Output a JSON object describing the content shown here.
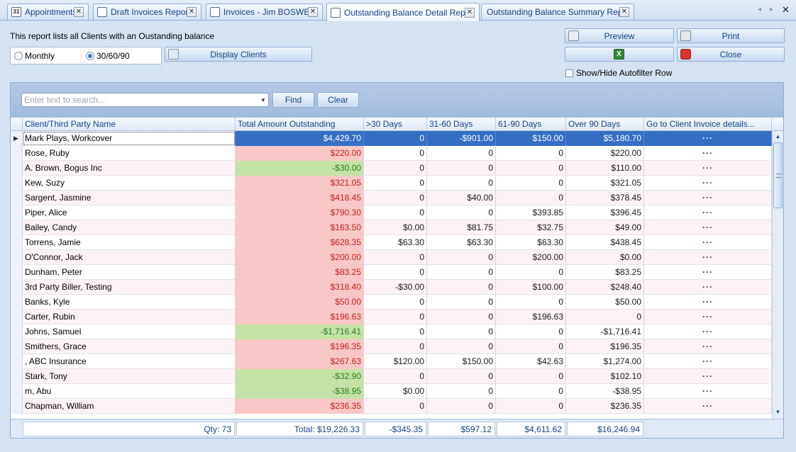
{
  "tabs": [
    {
      "label": "Appointments",
      "icon": "calendar-icon",
      "icon_text": "31",
      "active": false
    },
    {
      "label": "Draft Invoices Report",
      "icon": "report-icon",
      "icon_text": "",
      "active": false
    },
    {
      "label": "Invoices - Jim BOSWELL",
      "icon": "document-icon",
      "icon_text": "",
      "active": false
    },
    {
      "label": "Outstanding Balance Detail Report",
      "icon": "report-icon",
      "icon_text": "",
      "active": true
    },
    {
      "label": "Outstanding Balance Summary Report",
      "icon": "",
      "icon_text": "",
      "active": false
    }
  ],
  "tab_close_glyph": "✕",
  "tab_nav": {
    "prev": "◂",
    "next": "▸",
    "close_all": "✕"
  },
  "report": {
    "description": "This report lists all Clients with an Oustanding balance",
    "radio_monthly": "Monthly",
    "radio_306090": "30/60/90",
    "selected_period": "30/60/90",
    "display_clients": "Display Clients",
    "preview": "Preview",
    "print": "Print",
    "excel_icon_text": "X",
    "close": "Close",
    "autofilter_label": "Show/Hide Autofilter Row",
    "autofilter_checked": false
  },
  "search": {
    "placeholder": "Enter text to search...",
    "find": "Find",
    "clear": "Clear"
  },
  "columns": [
    "Client/Third Party Name",
    "Total Amount Outstanding",
    ">30 Days",
    "31-60 Days",
    "61-90 Days",
    "Over 90 Days",
    "Go to Client Invoice details..."
  ],
  "row_indicator": "▶",
  "row_action_glyph": "···",
  "rows": [
    {
      "name": "Mark Plays, Workcover",
      "total": "$4,429.70",
      "total_sign": "pos",
      "d30": "0",
      "d60": "-$901.00",
      "d90": "$150.00",
      "over90": "$5,180.70",
      "selected": true
    },
    {
      "name": "Rose, Ruby",
      "total": "$220.00",
      "total_sign": "pos",
      "d30": "0",
      "d60": "0",
      "d90": "0",
      "over90": "$220.00"
    },
    {
      "name": "A. Brown, Bogus Inc",
      "total": "-$30.00",
      "total_sign": "neg",
      "d30": "0",
      "d60": "0",
      "d90": "0",
      "over90": "$110.00"
    },
    {
      "name": "Kew, Suzy",
      "total": "$321.05",
      "total_sign": "pos",
      "d30": "0",
      "d60": "0",
      "d90": "0",
      "over90": "$321.05"
    },
    {
      "name": "Sargent, Jasmine",
      "total": "$418.45",
      "total_sign": "pos",
      "d30": "0",
      "d60": "$40.00",
      "d90": "0",
      "over90": "$378.45"
    },
    {
      "name": "Piper, Alice",
      "total": "$790.30",
      "total_sign": "pos",
      "d30": "0",
      "d60": "0",
      "d90": "$393.85",
      "over90": "$396.45"
    },
    {
      "name": "Bailey, Candy",
      "total": "$163.50",
      "total_sign": "pos",
      "d30": "$0.00",
      "d60": "$81.75",
      "d90": "$32.75",
      "over90": "$49.00"
    },
    {
      "name": "Torrens, Jamie",
      "total": "$628.35",
      "total_sign": "pos",
      "d30": "$63.30",
      "d60": "$63.30",
      "d90": "$63.30",
      "over90": "$438.45"
    },
    {
      "name": "O'Connor, Jack",
      "total": "$200.00",
      "total_sign": "pos",
      "d30": "0",
      "d60": "0",
      "d90": "$200.00",
      "over90": "$0.00"
    },
    {
      "name": "Dunham, Peter",
      "total": "$83.25",
      "total_sign": "pos",
      "d30": "0",
      "d60": "0",
      "d90": "0",
      "over90": "$83.25"
    },
    {
      "name": "3rd Party Biller, Testing",
      "total": "$318.40",
      "total_sign": "pos",
      "d30": "-$30.00",
      "d60": "0",
      "d90": "$100.00",
      "over90": "$248.40"
    },
    {
      "name": "Banks, Kyle",
      "total": "$50.00",
      "total_sign": "pos",
      "d30": "0",
      "d60": "0",
      "d90": "0",
      "over90": "$50.00"
    },
    {
      "name": "Carter, Rubin",
      "total": "$196.63",
      "total_sign": "pos",
      "d30": "0",
      "d60": "0",
      "d90": "$196.63",
      "over90": "0"
    },
    {
      "name": "Johns, Samuel",
      "total": "-$1,716.41",
      "total_sign": "neg",
      "d30": "0",
      "d60": "0",
      "d90": "0",
      "over90": "-$1,716.41"
    },
    {
      "name": "Smithers, Grace",
      "total": "$196.35",
      "total_sign": "pos",
      "d30": "0",
      "d60": "0",
      "d90": "0",
      "over90": "$196.35"
    },
    {
      "name": ", ABC Insurance",
      "total": "$267.63",
      "total_sign": "pos",
      "d30": "$120.00",
      "d60": "$150.00",
      "d90": "$42.63",
      "over90": "$1,274.00"
    },
    {
      "name": "Stark, Tony",
      "total": "-$32.90",
      "total_sign": "neg",
      "d30": "0",
      "d60": "0",
      "d90": "0",
      "over90": "$102.10"
    },
    {
      "name": "m, Abu",
      "total": "-$38.95",
      "total_sign": "neg",
      "d30": "$0.00",
      "d60": "0",
      "d90": "0",
      "over90": "-$38.95"
    },
    {
      "name": "Chapman, William",
      "total": "$236.35",
      "total_sign": "pos",
      "d30": "0",
      "d60": "0",
      "d90": "0",
      "over90": "$236.35"
    }
  ],
  "scrollbar": {
    "up": "▲",
    "down": "▼"
  },
  "footer": {
    "qty": "Qty: 73",
    "total": "Total: $19,226.33",
    "d30": "-$345.35",
    "d60": "$597.12",
    "d90": "$4,611.62",
    "over90": "$16,246.94"
  },
  "colors": {
    "positive_bg": "#f9c7c7",
    "negative_bg": "#c5e2a6",
    "selection": "#346fc4",
    "accent_text": "#15428b"
  }
}
